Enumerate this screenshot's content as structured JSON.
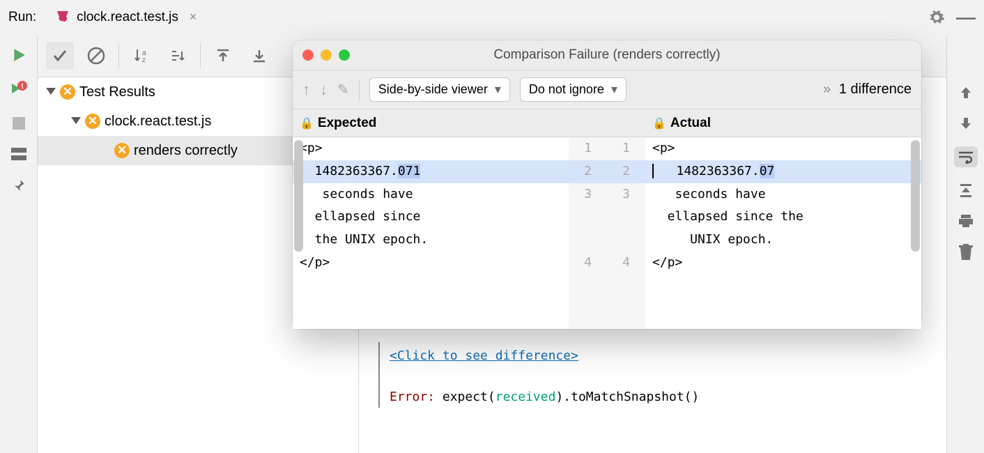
{
  "topbar": {
    "run_label": "Run:",
    "tab_label": "clock.react.test.js"
  },
  "tree": {
    "root": "Test Results",
    "file": "clock.react.test.js",
    "case": "renders correctly"
  },
  "console": {
    "click_line": "<Click to see difference>",
    "error_prefix": "Error:",
    "error_rest_1": " expect(",
    "error_received": "received",
    "error_rest_2": ").toMatchSnapshot()"
  },
  "dialog": {
    "title": "Comparison Failure (renders correctly)",
    "viewer_mode": "Side-by-side viewer",
    "ignore_mode": "Do not ignore",
    "diff_count": "1 difference",
    "expected_label": "Expected",
    "actual_label": "Actual",
    "expected_lines": {
      "l1": "<p>",
      "l2a": "  1482363367.",
      "l2b": "071",
      "l3": "   seconds have",
      "l3b": "  ellapsed since",
      "l3c": "  the UNIX epoch.",
      "l4": "</p>"
    },
    "actual_lines": {
      "l1": "<p>",
      "l2a": "   1482363367.",
      "l2b": "07",
      "l3": "   seconds have",
      "l3b": "  ellapsed since the",
      "l3c": "     UNIX epoch.",
      "l4": "</p>"
    },
    "line_numbers": {
      "n1": "1",
      "n2": "2",
      "n3": "3",
      "n4": "4"
    }
  }
}
